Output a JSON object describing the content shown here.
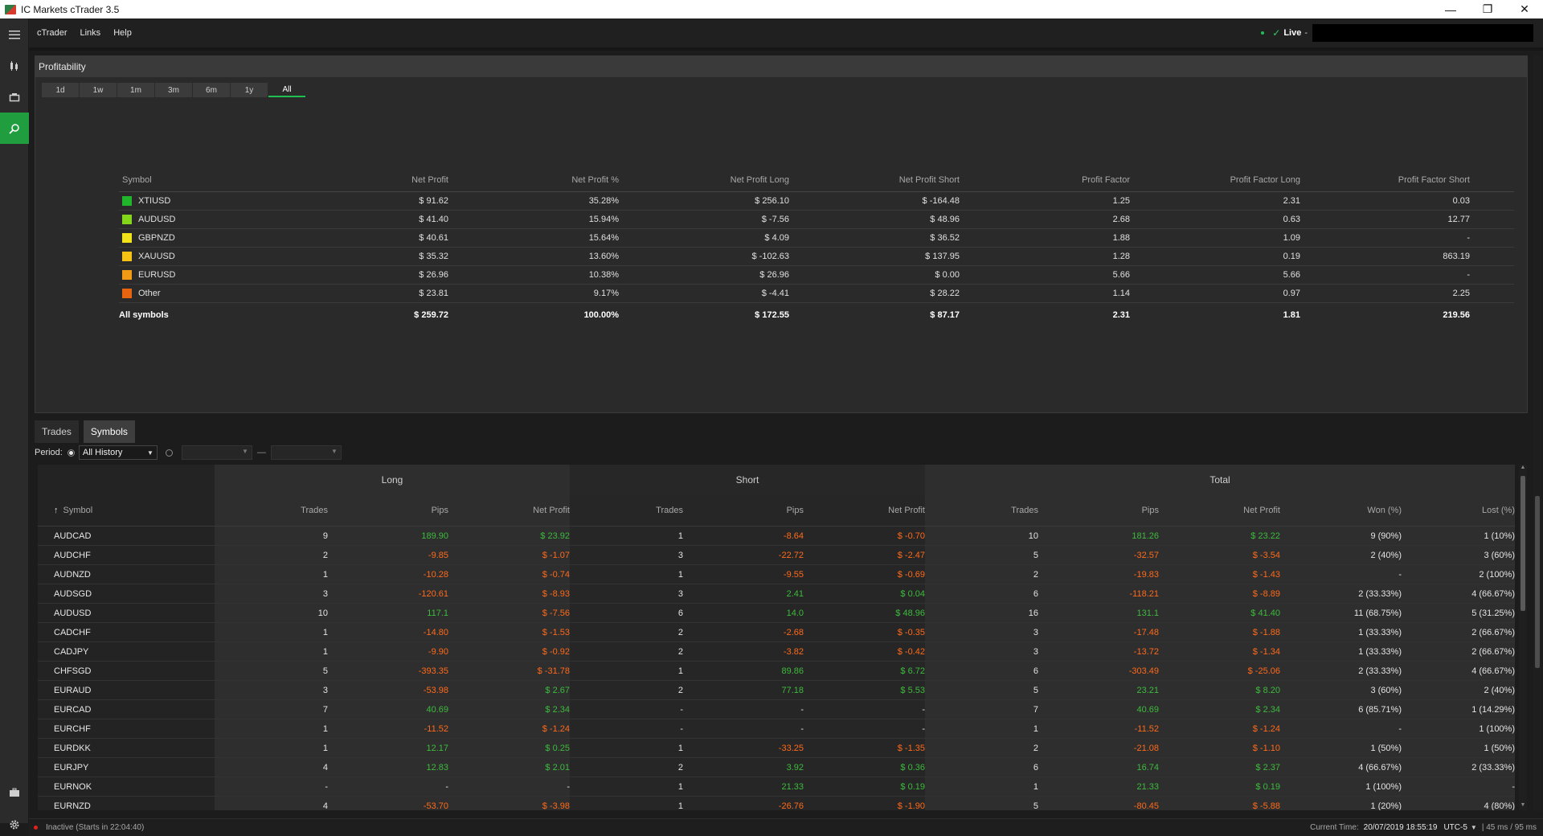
{
  "window": {
    "title": "IC Markets cTrader 3.5",
    "minimize": "—",
    "maximize": "❐",
    "close": "✕"
  },
  "menu": {
    "items": [
      "cTrader",
      "Links",
      "Help"
    ],
    "live_label": "Live",
    "live_dash": "-"
  },
  "profitability": {
    "title": "Profitability",
    "ranges": [
      "1d",
      "1w",
      "1m",
      "3m",
      "6m",
      "1y",
      "All"
    ],
    "active_range": "All",
    "columns": [
      "Symbol",
      "Net Profit",
      "Net Profit %",
      "Net Profit Long",
      "Net Profit Short",
      "Profit Factor",
      "Profit Factor Long",
      "Profit Factor Short"
    ],
    "rows": [
      {
        "symbol": "XTIUSD",
        "color": "#21b52c",
        "net_profit": "$ 91.62",
        "net_profit_pct": "35.28%",
        "np_long": "$ 256.10",
        "np_short": "$ -164.48",
        "pf": "1.25",
        "pf_long": "2.31",
        "pf_short": "0.03"
      },
      {
        "symbol": "AUDUSD",
        "color": "#84d61a",
        "net_profit": "$ 41.40",
        "net_profit_pct": "15.94%",
        "np_long": "$ -7.56",
        "np_short": "$ 48.96",
        "pf": "2.68",
        "pf_long": "0.63",
        "pf_short": "12.77"
      },
      {
        "symbol": "GBPNZD",
        "color": "#f2e21a",
        "net_profit": "$ 40.61",
        "net_profit_pct": "15.64%",
        "np_long": "$ 4.09",
        "np_short": "$ 36.52",
        "pf": "1.88",
        "pf_long": "1.09",
        "pf_short": "-"
      },
      {
        "symbol": "XAUUSD",
        "color": "#f5c313",
        "net_profit": "$ 35.32",
        "net_profit_pct": "13.60%",
        "np_long": "$ -102.63",
        "np_short": "$ 137.95",
        "pf": "1.28",
        "pf_long": "0.19",
        "pf_short": "863.19"
      },
      {
        "symbol": "EURUSD",
        "color": "#f09a15",
        "net_profit": "$ 26.96",
        "net_profit_pct": "10.38%",
        "np_long": "$ 26.96",
        "np_short": "$ 0.00",
        "pf": "5.66",
        "pf_long": "5.66",
        "pf_short": "-"
      },
      {
        "symbol": "Other",
        "color": "#e8640f",
        "net_profit": "$ 23.81",
        "net_profit_pct": "9.17%",
        "np_long": "$ -4.41",
        "np_short": "$ 28.22",
        "pf": "1.14",
        "pf_long": "0.97",
        "pf_short": "2.25"
      }
    ],
    "total": {
      "symbol": "All symbols",
      "net_profit": "$ 259.72",
      "net_profit_pct": "100.00%",
      "np_long": "$ 172.55",
      "np_short": "$ 87.17",
      "pf": "2.31",
      "pf_long": "1.81",
      "pf_short": "219.56"
    }
  },
  "bottom_tabs": [
    "Trades",
    "Symbols"
  ],
  "active_bottom_tab": "Symbols",
  "filter": {
    "period_label": "Period:",
    "period_value": "All History",
    "date_separator": "—"
  },
  "grid": {
    "groups": [
      "Long",
      "Short",
      "Total"
    ],
    "columns": [
      "Symbol",
      "Trades",
      "Pips",
      "Net Profit",
      "Trades",
      "Pips",
      "Net Profit",
      "Trades",
      "Pips",
      "Net Profit",
      "Won (%)",
      "Lost (%)"
    ],
    "sort_icon": "↑",
    "rows": [
      [
        "AUDCAD",
        "9",
        "189.90",
        "$ 23.92",
        "1",
        "-8.64",
        "$ -0.70",
        "10",
        "181.26",
        "$ 23.22",
        "9 (90%)",
        "1 (10%)"
      ],
      [
        "AUDCHF",
        "2",
        "-9.85",
        "$ -1.07",
        "3",
        "-22.72",
        "$ -2.47",
        "5",
        "-32.57",
        "$ -3.54",
        "2 (40%)",
        "3 (60%)"
      ],
      [
        "AUDNZD",
        "1",
        "-10.28",
        "$ -0.74",
        "1",
        "-9.55",
        "$ -0.69",
        "2",
        "-19.83",
        "$ -1.43",
        "-",
        "2 (100%)"
      ],
      [
        "AUDSGD",
        "3",
        "-120.61",
        "$ -8.93",
        "3",
        "2.41",
        "$ 0.04",
        "6",
        "-118.21",
        "$ -8.89",
        "2 (33.33%)",
        "4 (66.67%)"
      ],
      [
        "AUDUSD",
        "10",
        "117.1",
        "$ -7.56",
        "6",
        "14.0",
        "$ 48.96",
        "16",
        "131.1",
        "$ 41.40",
        "11 (68.75%)",
        "5 (31.25%)"
      ],
      [
        "CADCHF",
        "1",
        "-14.80",
        "$ -1.53",
        "2",
        "-2.68",
        "$ -0.35",
        "3",
        "-17.48",
        "$ -1.88",
        "1 (33.33%)",
        "2 (66.67%)"
      ],
      [
        "CADJPY",
        "1",
        "-9.90",
        "$ -0.92",
        "2",
        "-3.82",
        "$ -0.42",
        "3",
        "-13.72",
        "$ -1.34",
        "1 (33.33%)",
        "2 (66.67%)"
      ],
      [
        "CHFSGD",
        "5",
        "-393.35",
        "$ -31.78",
        "1",
        "89.86",
        "$ 6.72",
        "6",
        "-303.49",
        "$ -25.06",
        "2 (33.33%)",
        "4 (66.67%)"
      ],
      [
        "EURAUD",
        "3",
        "-53.98",
        "$ 2.67",
        "2",
        "77.18",
        "$ 5.53",
        "5",
        "23.21",
        "$ 8.20",
        "3 (60%)",
        "2 (40%)"
      ],
      [
        "EURCAD",
        "7",
        "40.69",
        "$ 2.34",
        "-",
        "-",
        "-",
        "7",
        "40.69",
        "$ 2.34",
        "6 (85.71%)",
        "1 (14.29%)"
      ],
      [
        "EURCHF",
        "1",
        "-11.52",
        "$ -1.24",
        "-",
        "-",
        "-",
        "1",
        "-11.52",
        "$ -1.24",
        "-",
        "1 (100%)"
      ],
      [
        "EURDKK",
        "1",
        "12.17",
        "$ 0.25",
        "1",
        "-33.25",
        "$ -1.35",
        "2",
        "-21.08",
        "$ -1.10",
        "1 (50%)",
        "1 (50%)"
      ],
      [
        "EURJPY",
        "4",
        "12.83",
        "$ 2.01",
        "2",
        "3.92",
        "$ 0.36",
        "6",
        "16.74",
        "$ 2.37",
        "4 (66.67%)",
        "2 (33.33%)"
      ],
      [
        "EURNOK",
        "-",
        "-",
        "-",
        "1",
        "21.33",
        "$ 0.19",
        "1",
        "21.33",
        "$ 0.19",
        "1 (100%)",
        "-"
      ],
      [
        "EURNZD",
        "4",
        "-53.70",
        "$ -3.98",
        "1",
        "-26.76",
        "$ -1.90",
        "5",
        "-80.45",
        "$ -5.88",
        "1 (20%)",
        "4 (80%)"
      ]
    ]
  },
  "status": {
    "state": "Inactive (Starts in 22:04:40)",
    "current_time_label": "Current Time:",
    "current_time_value": "20/07/2019 18:55:19",
    "timezone": "UTC-5",
    "ping": "| 45 ms / 95 ms"
  },
  "colors": {
    "accent": "#1f9d3f",
    "positive": "#3dbb3d",
    "negative": "#ff6a1a"
  },
  "icons": {
    "menu": "hamburger-icon",
    "trade": "trade-icon",
    "copy": "copy-icon",
    "analyze": "analyze-icon",
    "briefcase": "briefcase-icon",
    "settings": "gear-icon"
  }
}
